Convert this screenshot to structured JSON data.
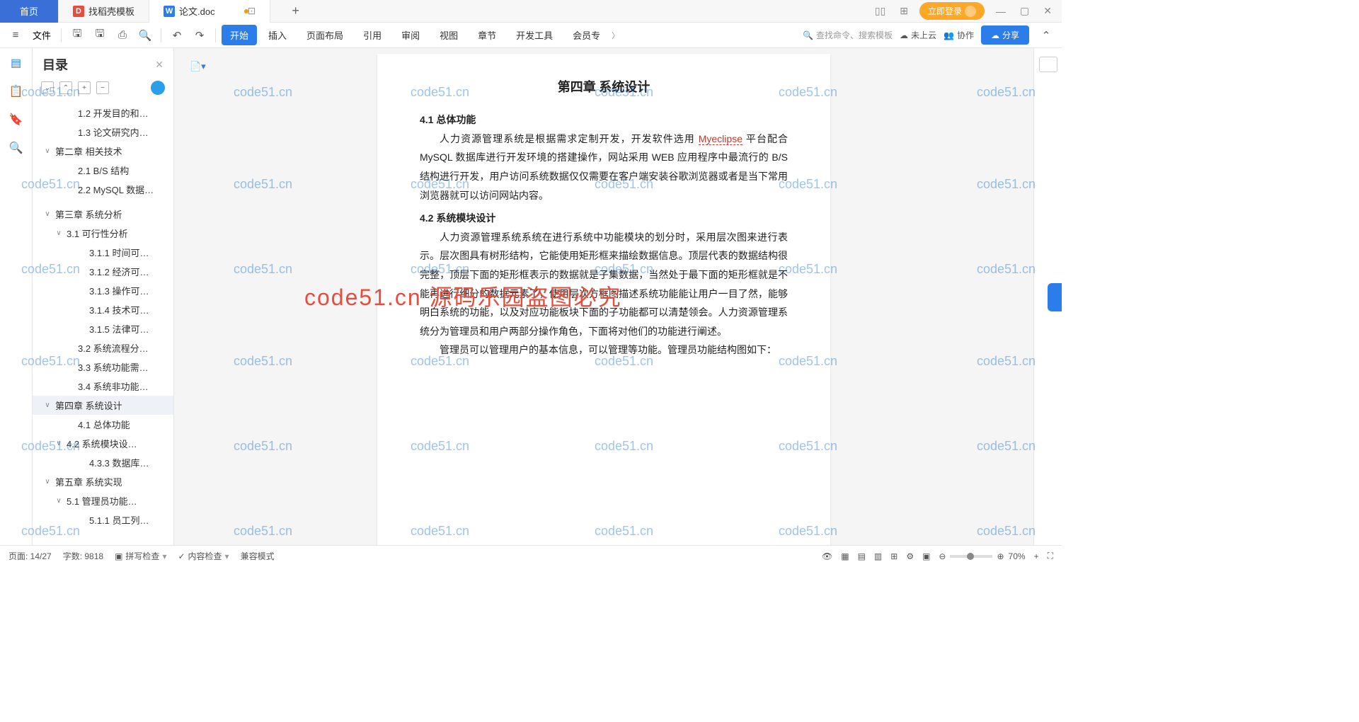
{
  "tabs": {
    "home": "首页",
    "t1": "找稻壳模板",
    "t2": "论文.doc"
  },
  "login_btn": "立即登录",
  "file_label": "文件",
  "ribbon": {
    "start": "开始",
    "insert": "插入",
    "layout": "页面布局",
    "ref": "引用",
    "review": "审阅",
    "view": "视图",
    "chapter": "章节",
    "dev": "开发工具",
    "member": "会员专"
  },
  "search_placeholder": "查找命令、搜索模板",
  "cloud": "未上云",
  "collab": "协作",
  "share": "分享",
  "outline": {
    "title": "目录",
    "items": [
      {
        "indent": 2,
        "label": "1.2 开发目的和…",
        "chev": ""
      },
      {
        "indent": 2,
        "label": "1.3 论文研究内…",
        "chev": ""
      },
      {
        "indent": 0,
        "label": "第二章 相关技术",
        "chev": "∨"
      },
      {
        "indent": 2,
        "label": "2.1 B/S 结构",
        "chev": ""
      },
      {
        "indent": 2,
        "label": "2.2 MySQL 数据…",
        "chev": ""
      },
      {
        "indent": 0,
        "label": "",
        "chev": ""
      },
      {
        "indent": 0,
        "label": "第三章  系统分析",
        "chev": "∨"
      },
      {
        "indent": 1,
        "label": "3.1 可行性分析",
        "chev": "∨"
      },
      {
        "indent": 3,
        "label": "3.1.1 时间可…",
        "chev": ""
      },
      {
        "indent": 3,
        "label": "3.1.2 经济可…",
        "chev": ""
      },
      {
        "indent": 3,
        "label": "3.1.3 操作可…",
        "chev": ""
      },
      {
        "indent": 3,
        "label": "3.1.4 技术可…",
        "chev": ""
      },
      {
        "indent": 3,
        "label": "3.1.5 法律可…",
        "chev": ""
      },
      {
        "indent": 2,
        "label": "3.2 系统流程分…",
        "chev": ""
      },
      {
        "indent": 2,
        "label": "3.3 系统功能需…",
        "chev": ""
      },
      {
        "indent": 2,
        "label": "3.4 系统非功能…",
        "chev": ""
      },
      {
        "indent": 0,
        "label": "第四章  系统设计",
        "chev": "∨",
        "sel": true
      },
      {
        "indent": 2,
        "label": "4.1 总体功能",
        "chev": ""
      },
      {
        "indent": 1,
        "label": "4.2 系统模块设…",
        "chev": "∨"
      },
      {
        "indent": 3,
        "label": "4.3.3 数据库…",
        "chev": ""
      },
      {
        "indent": 0,
        "label": "第五章  系统实现",
        "chev": "∨"
      },
      {
        "indent": 1,
        "label": "5.1 管理员功能…",
        "chev": "∨"
      },
      {
        "indent": 3,
        "label": "5.1.1 员工列…",
        "chev": ""
      }
    ]
  },
  "doc": {
    "chapter": "第四章  系统设计",
    "s41": "4.1  总体功能",
    "p1a": "人力资源管理系统是根据需求定制开发，开发软件选用 ",
    "p1b": "Myeclipse",
    "p1c": " 平台配合 MySQL 数据库进行开发环境的搭建操作，网站采用 WEB 应用程序中最流行的 B/S 结构进行开发，用户访问系统数据仅仅需要在客户端安装谷歌浏览器或者是当下常用浏览器就可以访问网站内容。",
    "s42": "4.2  系统模块设计",
    "p2": "人力资源管理系统系统在进行系统中功能模块的划分时，采用层次图来进行表示。层次图具有树形结构，它能使用矩形框来描绘数据信息。顶层代表的数据结构很完整，顶层下面的矩形框表示的数据就是子集数据，当然处于最下面的矩形框就是不能再进行细分的数据元素了，使用层次方框图描述系统功能能让用户一目了然，能够明白系统的功能，以及对应功能板块下面的子功能都可以清楚领会。人力资源管理系统分为管理员和用户两部分操作角色，下面将对他们的功能进行阐述。",
    "p3": "管理员可以管理用户的基本信息，可以管理等功能。管理员功能结构图如下："
  },
  "status": {
    "page": "页面: 14/27",
    "words": "字数: 9818",
    "spell": "拼写检查",
    "content": "内容检查",
    "compat": "兼容模式",
    "zoom": "70%"
  },
  "watermark": "code51.cn",
  "watermark_big": "code51.cn 源码乐园盗图必究"
}
